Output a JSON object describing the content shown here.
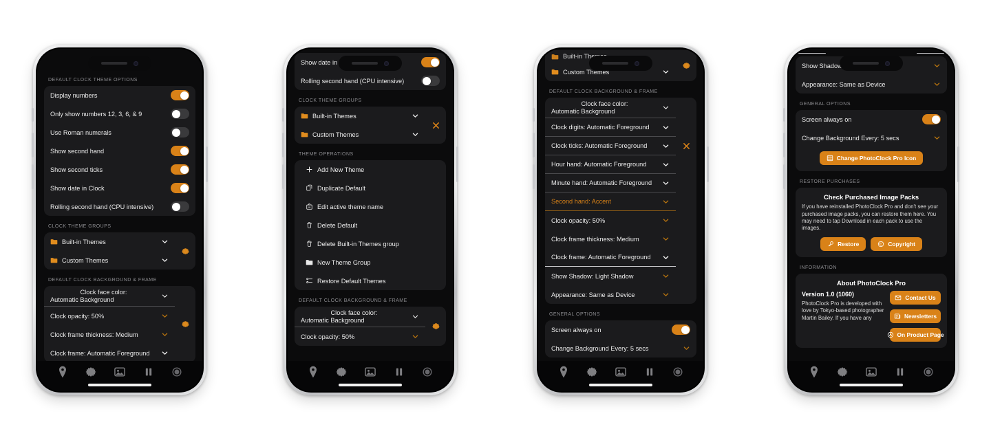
{
  "app": {
    "name": "PhotoClock Pro"
  },
  "colors": {
    "accent": "#d98218",
    "card": "#1b1b1d",
    "screen": "#0b0b0c",
    "page": "#ffffff"
  },
  "tabbar": {
    "items": [
      "clock-icon",
      "gear-icon",
      "photo-icon",
      "pause-icon",
      "record-icon"
    ]
  },
  "phone1": {
    "sections": {
      "theme_options": "DEFAULT CLOCK THEME OPTIONS",
      "theme_groups": "CLOCK THEME GROUPS",
      "background_frame": "DEFAULT CLOCK BACKGROUND & FRAME"
    },
    "toggles": [
      {
        "label": "Display numbers",
        "on": true
      },
      {
        "label": "Only show numbers 12, 3, 6, & 9",
        "on": false
      },
      {
        "label": "Use Roman numerals",
        "on": false
      },
      {
        "label": "Show second hand",
        "on": true
      },
      {
        "label": "Show second ticks",
        "on": true
      },
      {
        "label": "Show date in Clock",
        "on": true
      },
      {
        "label": "Rolling second hand (CPU intensive)",
        "on": false
      }
    ],
    "groups": [
      {
        "label": "Built-in Themes"
      },
      {
        "label": "Custom Themes"
      }
    ],
    "picker": {
      "line1": "Clock face color:",
      "line2": "Automatic Background"
    },
    "rows": [
      {
        "label": "Clock opacity: 50%"
      },
      {
        "label": "Clock frame thickness: Medium"
      },
      {
        "label": "Clock frame: Automatic Foreground"
      }
    ]
  },
  "phone2": {
    "sections": {
      "theme_groups": "CLOCK THEME GROUPS",
      "theme_operations": "THEME OPERATIONS",
      "background_frame": "DEFAULT CLOCK BACKGROUND & FRAME"
    },
    "top_toggles": [
      {
        "label": "Show date in Clock",
        "on": true
      },
      {
        "label": "Rolling second hand (CPU intensive)",
        "on": false
      }
    ],
    "groups": [
      {
        "label": "Built-in Themes"
      },
      {
        "label": "Custom Themes"
      }
    ],
    "operations": [
      {
        "label": "Add New Theme",
        "icon": "plus-icon"
      },
      {
        "label": "Duplicate Default",
        "icon": "duplicate-icon"
      },
      {
        "label": "Edit active theme name",
        "icon": "edit-icon"
      },
      {
        "label": "Delete Default",
        "icon": "trash-icon"
      },
      {
        "label": "Delete Built-in Themes group",
        "icon": "trash-icon"
      },
      {
        "label": "New Theme Group",
        "icon": "folder-icon"
      },
      {
        "label": "Restore Default Themes",
        "icon": "restore-icon"
      }
    ],
    "picker": {
      "line1": "Clock face color:",
      "line2": "Automatic Background"
    },
    "rows": [
      {
        "label": "Clock opacity: 50%"
      }
    ]
  },
  "phone3": {
    "sections": {
      "background_frame": "DEFAULT CLOCK BACKGROUND & FRAME",
      "general_options": "GENERAL OPTIONS"
    },
    "groups": [
      {
        "label": "Built-in Themes"
      },
      {
        "label": "Custom Themes"
      }
    ],
    "picker": {
      "line1": "Clock face color:",
      "line2": "Automatic Background"
    },
    "rows": [
      {
        "label": "Clock digits: Automatic Foreground",
        "style": "normal"
      },
      {
        "label": "Clock ticks: Automatic Foreground",
        "style": "normal"
      },
      {
        "label": "Hour hand: Automatic Foreground",
        "style": "normal"
      },
      {
        "label": "Minute hand: Automatic Foreground",
        "style": "normal"
      },
      {
        "label": "Second hand: Accent",
        "style": "accent"
      },
      {
        "label": "Clock opacity: 50%",
        "style": "plain"
      },
      {
        "label": "Clock frame thickness: Medium",
        "style": "plain"
      },
      {
        "label": "Clock frame: Automatic Foreground",
        "style": "focused"
      },
      {
        "label": "Show Shadow: Light Shadow",
        "style": "plain"
      },
      {
        "label": "Appearance: Same as Device",
        "style": "plain"
      }
    ],
    "general": [
      {
        "label": "Screen always on",
        "on": true
      },
      {
        "label": "Change Background Every: 5 secs"
      }
    ]
  },
  "phone4": {
    "sections": {
      "general_options": "GENERAL OPTIONS",
      "restore_purchases": "RESTORE PURCHASES",
      "information": "INFORMATION"
    },
    "top_rows": [
      {
        "label": "Show Shadow: Light Shadow"
      },
      {
        "label": "Appearance: Same as Device"
      }
    ],
    "general": [
      {
        "label": "Screen always on",
        "on": true
      },
      {
        "label": "Change Background Every: 5 secs"
      }
    ],
    "change_icon_button": {
      "label": "Change PhotoClock Pro Icon",
      "icon": "grid-icon"
    },
    "restore": {
      "title": "Check Purchased Image Packs",
      "body": "If you have reinstalled PhotoClock Pro and don't see your purchased image packs, you can restore them here. You may need to tap Download in each pack to use the images.",
      "buttons": [
        {
          "label": "Restore",
          "icon": "key-icon"
        },
        {
          "label": "Copyright",
          "icon": "copyright-icon"
        }
      ]
    },
    "about": {
      "title": "About PhotoClock Pro",
      "version": "Version 1.0 (1060)",
      "body": "PhotoClock Pro is developed with love by Tokyo-based photographer Martin Bailey. If you have any",
      "buttons": [
        {
          "label": "Contact Us",
          "icon": "mail-icon"
        },
        {
          "label": "Newsletters",
          "icon": "news-icon"
        },
        {
          "label": "On Product Page",
          "icon": "store-icon"
        }
      ]
    }
  }
}
